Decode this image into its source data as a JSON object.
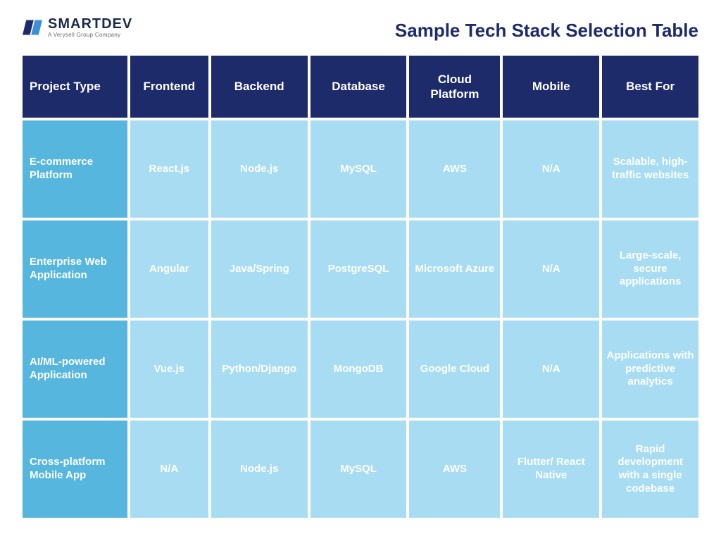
{
  "brand": {
    "name": "SMARTDEV",
    "tagline": "A Verysell Group Company"
  },
  "page_title": "Sample Tech Stack Selection Table",
  "chart_data": {
    "type": "table",
    "columns": [
      "Project Type",
      "Frontend",
      "Backend",
      "Database",
      "Cloud Platform",
      "Mobile",
      "Best For"
    ],
    "rows": [
      {
        "project_type": "E-commerce Platform",
        "frontend": "React.js",
        "backend": "Node.js",
        "database": "MySQL",
        "cloud_platform": "AWS",
        "mobile": "N/A",
        "best_for": "Scalable, high-traffic websites"
      },
      {
        "project_type": "Enterprise Web Application",
        "frontend": "Angular",
        "backend": "Java/Spring",
        "database": "PostgreSQL",
        "cloud_platform": "Microsoft Azure",
        "mobile": "N/A",
        "best_for": "Large-scale, secure applications"
      },
      {
        "project_type": "AI/ML-powered Application",
        "frontend": "Vue.js",
        "backend": "Python/Django",
        "database": "MongoDB",
        "cloud_platform": "Google Cloud",
        "mobile": "N/A",
        "best_for": "Applications with predictive analytics"
      },
      {
        "project_type": "Cross-platform Mobile App",
        "frontend": "N/A",
        "backend": "Node.js",
        "database": "MySQL",
        "cloud_platform": "AWS",
        "mobile": "Flutter/ React Native",
        "best_for": "Rapid development with a single codebase"
      }
    ]
  }
}
